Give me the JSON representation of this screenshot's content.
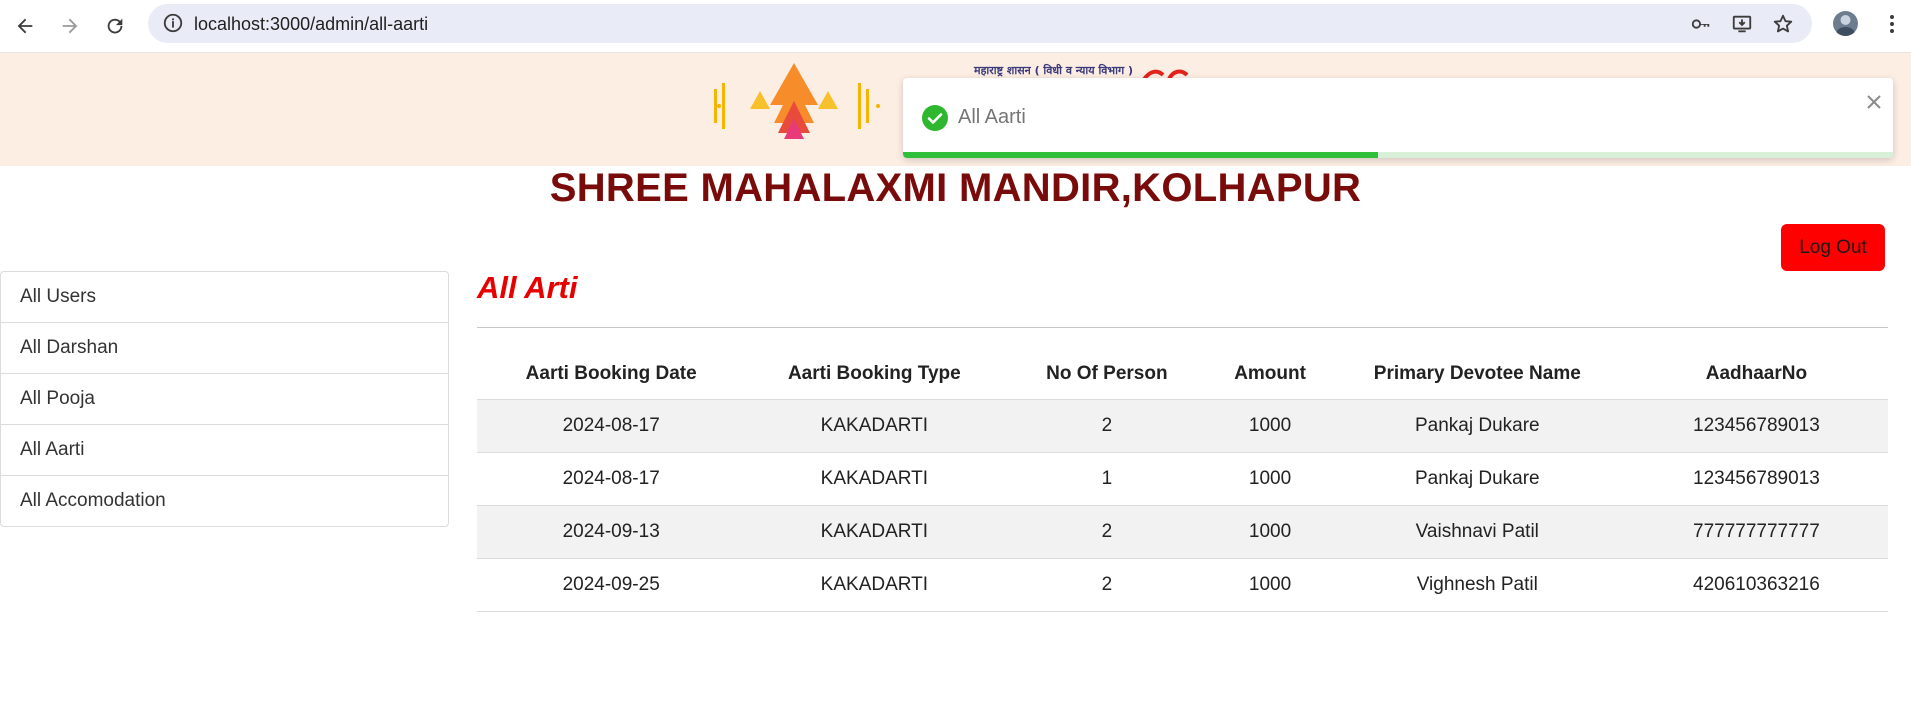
{
  "browser": {
    "url": "localhost:3000/admin/all-aarti"
  },
  "banner": {
    "subtext": "महाराष्ट्र शासन ( विधी व न्याय विभाग )"
  },
  "toast": {
    "message": "All Aarti",
    "progress_percent": 48
  },
  "site_title": "SHREE MAHALAXMI MANDIR,KOLHAPUR",
  "logout_label": "Log Out",
  "sidebar": {
    "items": [
      {
        "label": "All Users"
      },
      {
        "label": "All Darshan"
      },
      {
        "label": "All Pooja"
      },
      {
        "label": "All Aarti"
      },
      {
        "label": "All Accomodation"
      }
    ]
  },
  "main": {
    "heading": "All Arti",
    "table": {
      "headers": [
        "Aarti Booking Date",
        "Aarti Booking Type",
        "No Of Person",
        "Amount",
        "Primary Devotee Name",
        "AadhaarNo"
      ],
      "rows": [
        [
          "2024-08-17",
          "KAKADARTI",
          "2",
          "1000",
          "Pankaj Dukare",
          "123456789013"
        ],
        [
          "2024-08-17",
          "KAKADARTI",
          "1",
          "1000",
          "Pankaj Dukare",
          "123456789013"
        ],
        [
          "2024-09-13",
          "KAKADARTI",
          "2",
          "1000",
          "Vaishnavi Patil",
          "777777777777"
        ],
        [
          "2024-09-25",
          "KAKADARTI",
          "2",
          "1000",
          "Vighnesh Patil",
          "420610363216"
        ]
      ]
    }
  },
  "colors": {
    "banner_bg": "#fdeee4",
    "title": "#7a0b0b",
    "heading": "#e60000",
    "logout_bg": "#ff0000",
    "toast_progress": "#2fbf3a"
  },
  "icons": {
    "back": "back-arrow-icon",
    "forward": "forward-arrow-icon",
    "reload": "reload-icon",
    "site_info": "info-icon",
    "password": "key-icon",
    "install": "install-app-icon",
    "bookmark": "star-icon",
    "menu": "kebab-menu-icon",
    "toast_success": "check-circle-icon",
    "toast_close": "close-icon"
  }
}
